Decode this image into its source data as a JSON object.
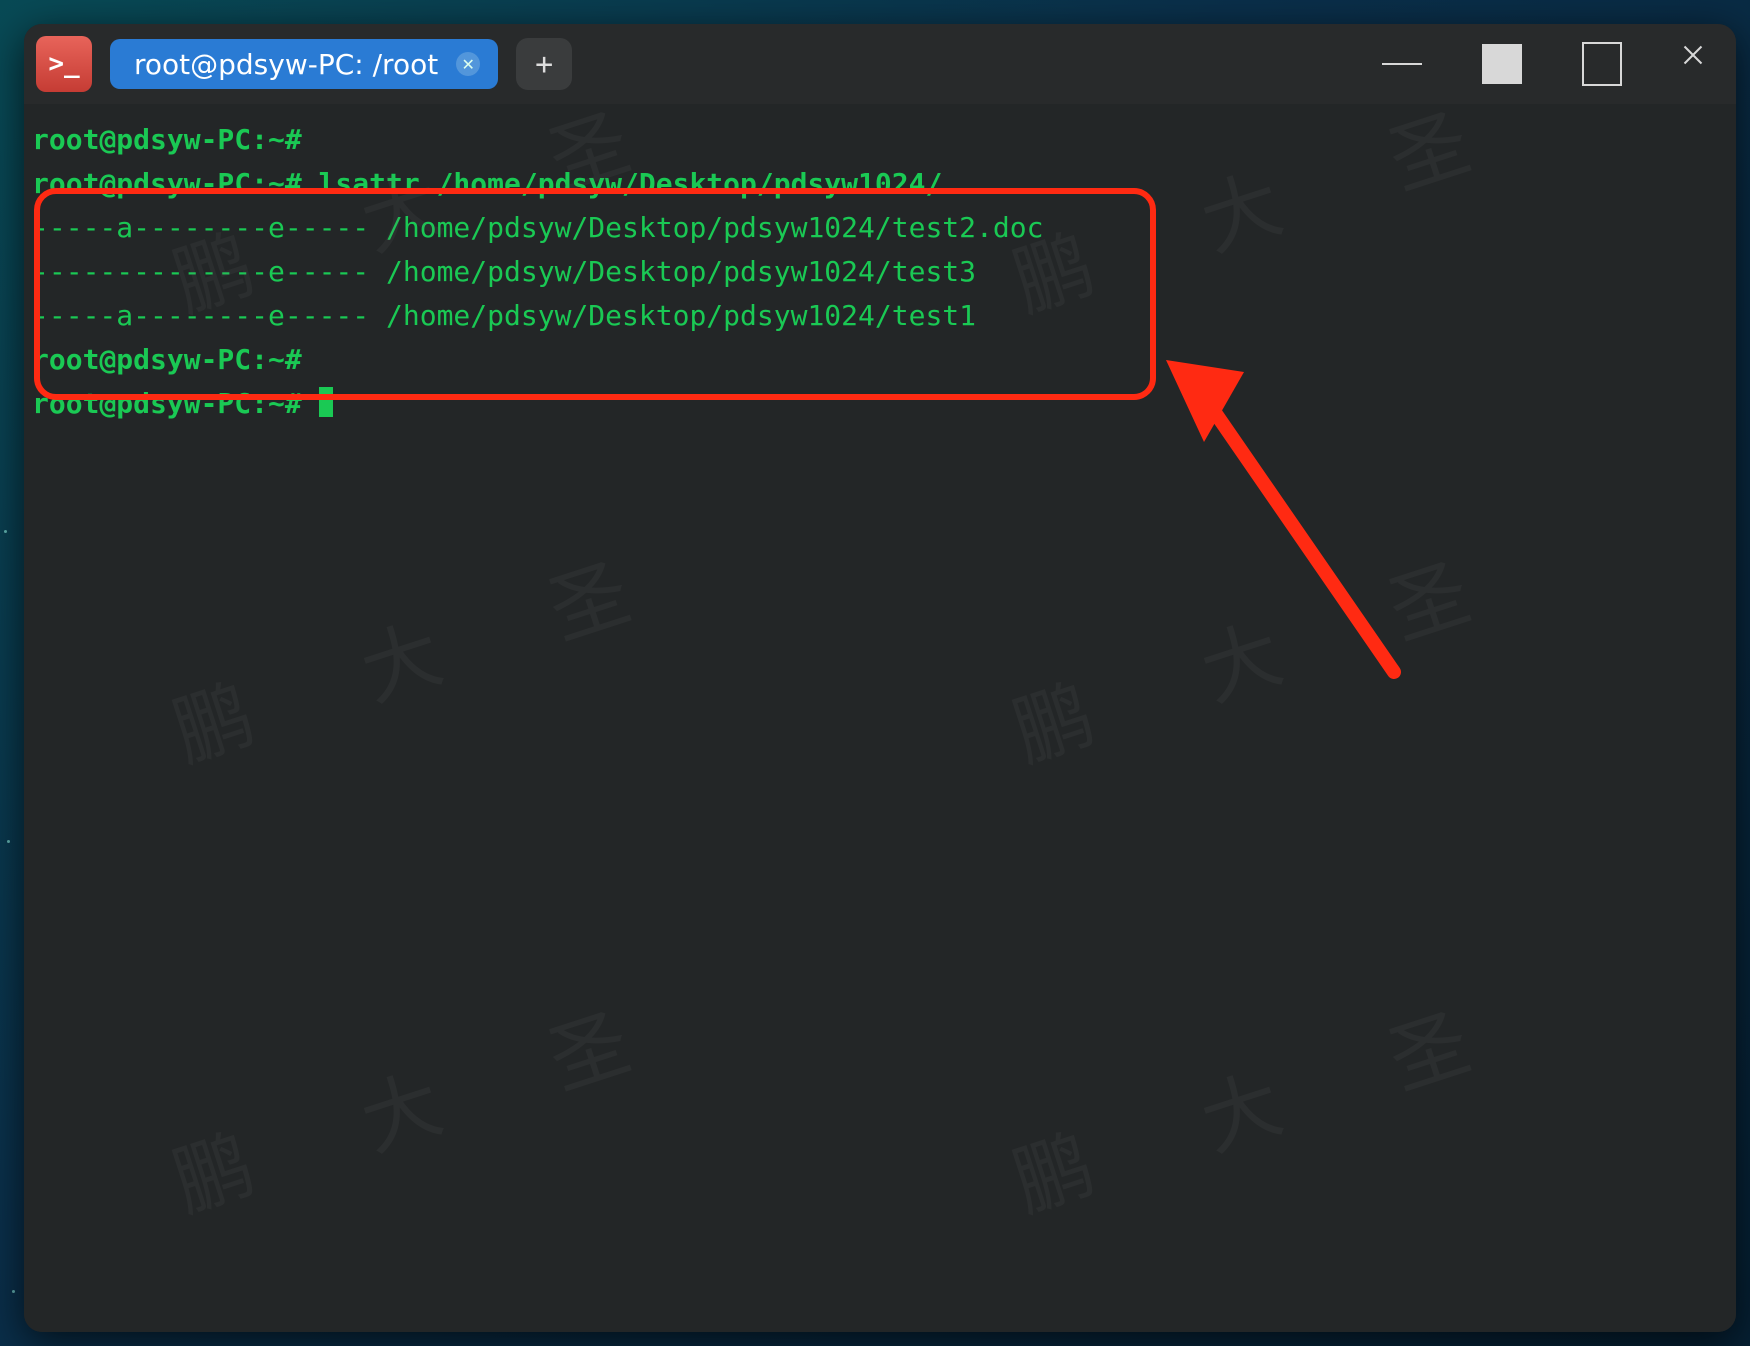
{
  "tab": {
    "title": "root@pdsyw-PC: /root"
  },
  "watermark": "鹏 大 圣",
  "terminal": {
    "prompt": "root@pdsyw-PC:~#",
    "cmd1": "lsattr /home/pdsyw/Desktop/pdsyw1024/",
    "lines": [
      "root@pdsyw-PC:~#",
      "root@pdsyw-PC:~# lsattr /home/pdsyw/Desktop/pdsyw1024/",
      "-----a--------e----- /home/pdsyw/Desktop/pdsyw1024/test2.doc",
      "--------------e----- /home/pdsyw/Desktop/pdsyw1024/test3",
      "-----a--------e----- /home/pdsyw/Desktop/pdsyw1024/test1",
      "root@pdsyw-PC:~#",
      "root@pdsyw-PC:~# "
    ],
    "lsattr_output": [
      {
        "attrs": "-----a--------e-----",
        "file": "/home/pdsyw/Desktop/pdsyw1024/test2.doc"
      },
      {
        "attrs": "--------------e-----",
        "file": "/home/pdsyw/Desktop/pdsyw1024/test3"
      },
      {
        "attrs": "-----a--------e-----",
        "file": "/home/pdsyw/Desktop/pdsyw1024/test1"
      }
    ]
  }
}
